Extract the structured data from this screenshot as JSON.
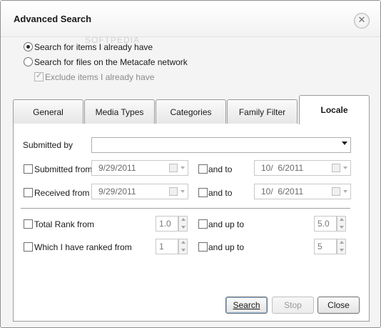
{
  "window": {
    "title": "Advanced Search",
    "watermark": "SOFTPEDIA"
  },
  "scope": {
    "option_local": "Search for items I already have",
    "option_network": "Search for files on the Metacafe network",
    "exclude_label": "Exclude items I already have",
    "selected": "option_local"
  },
  "tabs": [
    "General",
    "Media Types",
    "Categories",
    "Family Filter",
    "Locale"
  ],
  "active_tab": "Locale",
  "form": {
    "submitted_by_label": "Submitted by",
    "submitted_by_value": "",
    "submitted_from_label": "Submitted from",
    "submitted_from_date": "9/29/2011",
    "submitted_to_label": "and to",
    "submitted_to_date": "10/  6/2011",
    "received_from_label": "Received from",
    "received_from_date": "9/29/2011",
    "received_to_label": "and to",
    "received_to_date": "10/  6/2011",
    "total_rank_label": "Total Rank from",
    "total_rank_from": "1.0",
    "total_rank_upto_label": "and up to",
    "total_rank_upto": "5.0",
    "my_rank_label": "Which I have ranked from",
    "my_rank_from": "1",
    "my_rank_upto_label": "and up to",
    "my_rank_upto": "5"
  },
  "buttons": {
    "search": "Search",
    "stop": "Stop",
    "close": "Close"
  }
}
